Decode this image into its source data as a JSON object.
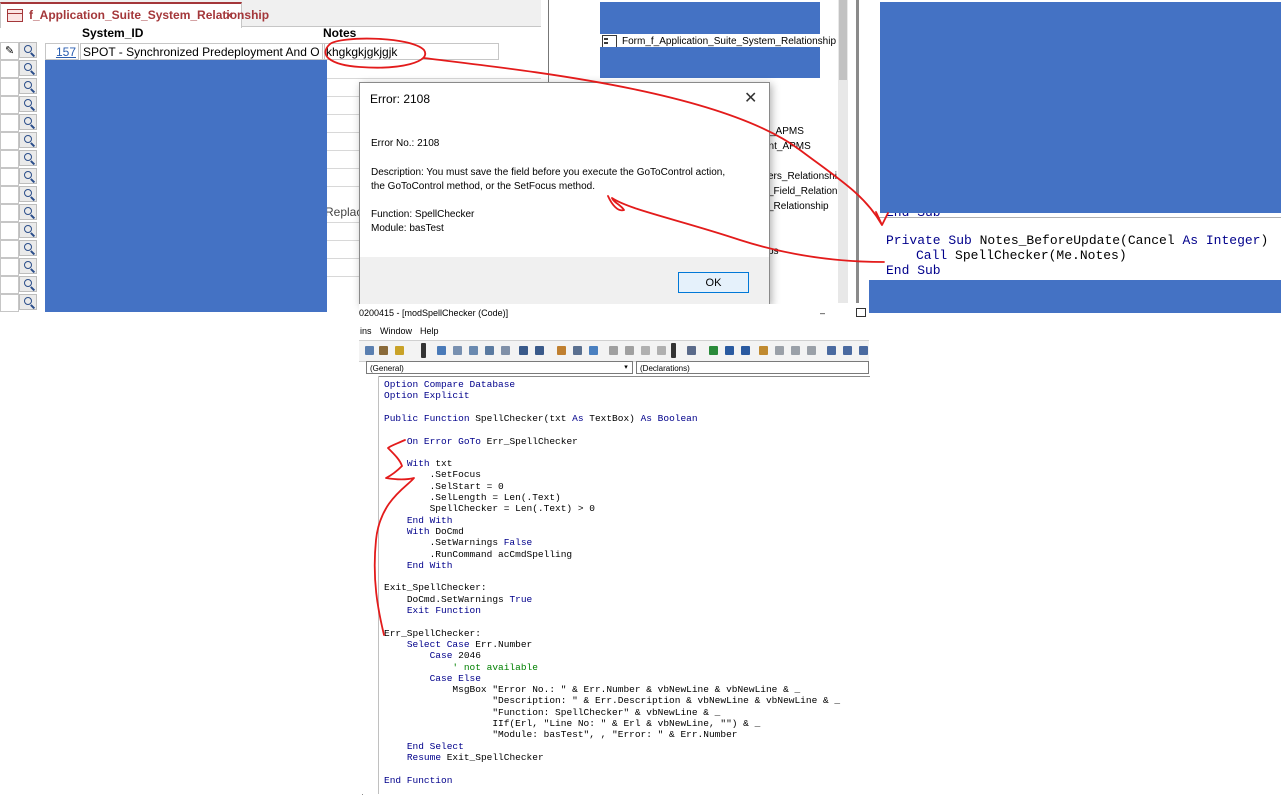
{
  "access": {
    "tab_title": "f_Application_Suite_System_Relationship",
    "tab_close": "×",
    "col_system_id": "System_ID",
    "col_notes": "Notes",
    "row1_id": "157",
    "row1_name": "SPOT - Synchronized Predeployment And O",
    "row1_notes": "khgkgkjgkjgjk",
    "replace_fragment": "Replac"
  },
  "nav_pane": {
    "items": [
      "Form_f_Application_Suite_System_Relationship",
      "_APMS",
      "ent_APMS",
      "ers_Relationshi",
      "_Field_Relation",
      "_Relationship",
      "ps"
    ]
  },
  "right_code": {
    "partial_line": "End Sub",
    "line1_kw1": "Private Sub",
    "line1_rest": " Notes_BeforeUpdate(Cancel ",
    "line1_kw2": "As Integer",
    "line1_end": ")",
    "line2_kw": "Call",
    "line2_rest": " SpellChecker(Me.Notes)",
    "line3": "End Sub"
  },
  "dialog": {
    "title": "Error: 2108",
    "close": "✕",
    "error_no": "Error No.: 2108",
    "desc_line1": "Description: You must save the field before you execute the GoToControl action,",
    "desc_line2": "the GoToControl method, or the SetFocus method.",
    "function": "Function: SpellChecker",
    "module": "Module: basTest",
    "ok": "OK"
  },
  "vbe": {
    "title": "0200415 - [modSpellChecker (Code)]",
    "min": "–",
    "menu": [
      "ins",
      "Window",
      "Help"
    ],
    "combo_general": "(General)",
    "combo_declarations": "(Declarations)",
    "code": [
      {
        "kw": "Option Compare Database",
        "rest": ""
      },
      {
        "kw": "Option Explicit",
        "rest": ""
      },
      {
        "kw": "",
        "rest": ""
      },
      {
        "kw": "Public Function",
        "rest": " SpellChecker(txt ",
        "kw2": "As",
        "rest2": " TextBox) ",
        "kw3": "As Boolean"
      },
      {
        "kw": "",
        "rest": ""
      },
      {
        "indent": "    ",
        "kw": "On Error GoTo",
        "rest": " Err_SpellChecker"
      },
      {
        "kw": "",
        "rest": ""
      },
      {
        "indent": "    ",
        "kw": "With",
        "rest": " txt"
      },
      {
        "indent": "        ",
        "kw": "",
        "rest": ".SetFocus"
      },
      {
        "indent": "        ",
        "kw": "",
        "rest": ".SelStart = 0"
      },
      {
        "indent": "        ",
        "kw": "",
        "rest": ".SelLength = Len(.Text)"
      },
      {
        "indent": "        ",
        "kw": "",
        "rest": "SpellChecker = Len(.Text) > 0"
      },
      {
        "indent": "    ",
        "kw": "End With",
        "rest": ""
      },
      {
        "indent": "    ",
        "kw": "With",
        "rest": " DoCmd"
      },
      {
        "indent": "        ",
        "kw": "",
        "rest": ".SetWarnings ",
        "kw2": "False"
      },
      {
        "indent": "        ",
        "kw": "",
        "rest": ".RunCommand acCmdSpelling"
      },
      {
        "indent": "    ",
        "kw": "End With",
        "rest": ""
      },
      {
        "kw": "",
        "rest": ""
      },
      {
        "kw": "",
        "rest": "Exit_SpellChecker:"
      },
      {
        "indent": "    ",
        "kw": "",
        "rest": "DoCmd.SetWarnings ",
        "kw2": "True"
      },
      {
        "indent": "    ",
        "kw": "Exit Function",
        "rest": ""
      },
      {
        "kw": "",
        "rest": ""
      },
      {
        "kw": "",
        "rest": "Err_SpellChecker:"
      },
      {
        "indent": "    ",
        "kw": "Select Case",
        "rest": " Err.Number"
      },
      {
        "indent": "        ",
        "kw": "Case",
        "rest": " 2046"
      },
      {
        "indent": "            ",
        "kw": "",
        "rest": "",
        "comment": "' not available"
      },
      {
        "indent": "        ",
        "kw": "Case Else",
        "rest": ""
      },
      {
        "indent": "            ",
        "kw": "",
        "rest": "MsgBox \"Error No.: \" & Err.Number & vbNewLine & vbNewLine & _"
      },
      {
        "indent": "                   ",
        "kw": "",
        "rest": "\"Description: \" & Err.Description & vbNewLine & vbNewLine & _"
      },
      {
        "indent": "                   ",
        "kw": "",
        "rest": "\"Function: SpellChecker\" & vbNewLine & _"
      },
      {
        "indent": "                   ",
        "kw": "",
        "rest": "IIf(Erl, \"Line No: \" & Erl & vbNewLine, \"\") & _"
      },
      {
        "indent": "                   ",
        "kw": "",
        "rest": "\"Module: basTest\", , \"Error: \" & Err.Number"
      },
      {
        "indent": "    ",
        "kw": "End Select",
        "rest": ""
      },
      {
        "indent": "    ",
        "kw": "Resume",
        "rest": " Exit_SpellChecker"
      },
      {
        "kw": "",
        "rest": ""
      },
      {
        "kw": "End Function",
        "rest": ""
      }
    ]
  },
  "colors": {
    "redaction": "#4472c4",
    "annotation": "#e31b1b",
    "vba_keyword": "#00008b",
    "vba_comment": "#008000"
  }
}
